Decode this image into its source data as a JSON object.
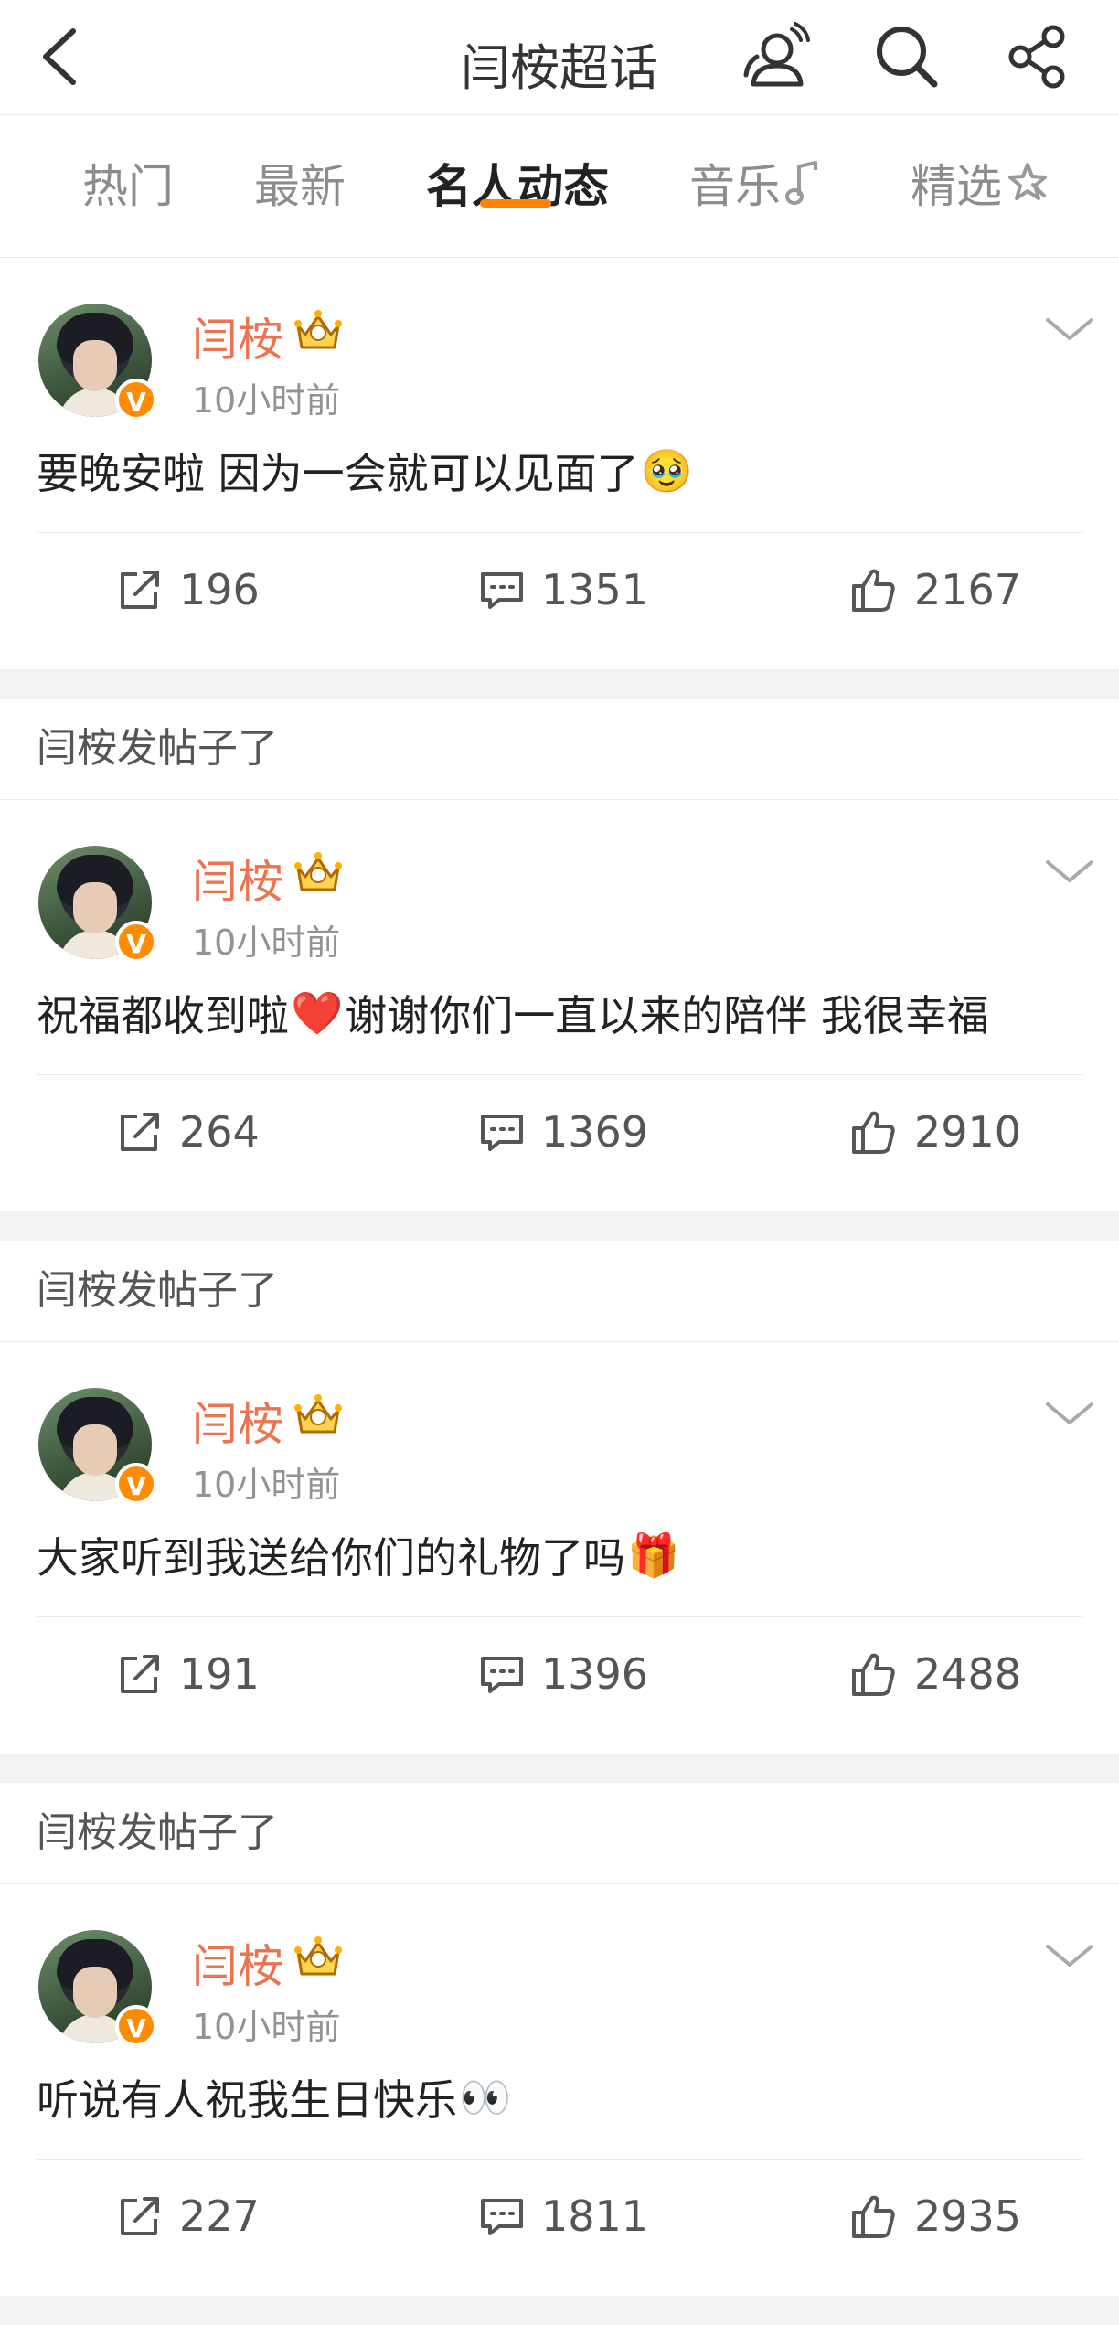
{
  "header": {
    "title": "闫桉超话",
    "icons": [
      "back-arrow-icon",
      "user-group-icon",
      "search-icon",
      "share-icon"
    ]
  },
  "tabs": [
    {
      "label": "热门"
    },
    {
      "label": "最新"
    },
    {
      "label": "名人动态"
    },
    {
      "label": "音乐"
    },
    {
      "label": "精选"
    }
  ],
  "accent_color": "#ff8200",
  "name_color": "#eb7350",
  "posts": [
    {
      "section_label": "",
      "username": "闫桉",
      "time": "10小时前",
      "text": "要晚安啦 因为一会就可以见面了",
      "emoji": "🥹",
      "repost": "196",
      "comment": "1351",
      "like": "2167"
    },
    {
      "section_label": "闫桉发帖子了",
      "username": "闫桉",
      "time": "10小时前",
      "text_before": "祝福都收到啦",
      "emoji": "❤️",
      "text_after": "谢谢你们一直以来的陪伴 我很幸福",
      "repost": "264",
      "comment": "1369",
      "like": "2910"
    },
    {
      "section_label": "闫桉发帖子了",
      "username": "闫桉",
      "time": "10小时前",
      "text": "大家听到我送给你们的礼物了吗",
      "emoji": "🎁",
      "repost": "191",
      "comment": "1396",
      "like": "2488"
    },
    {
      "section_label": "闫桉发帖子了",
      "username": "闫桉",
      "time": "10小时前",
      "text": "听说有人祝我生日快乐",
      "emoji": "👀",
      "repost": "227",
      "comment": "1811",
      "like": "2935"
    }
  ]
}
